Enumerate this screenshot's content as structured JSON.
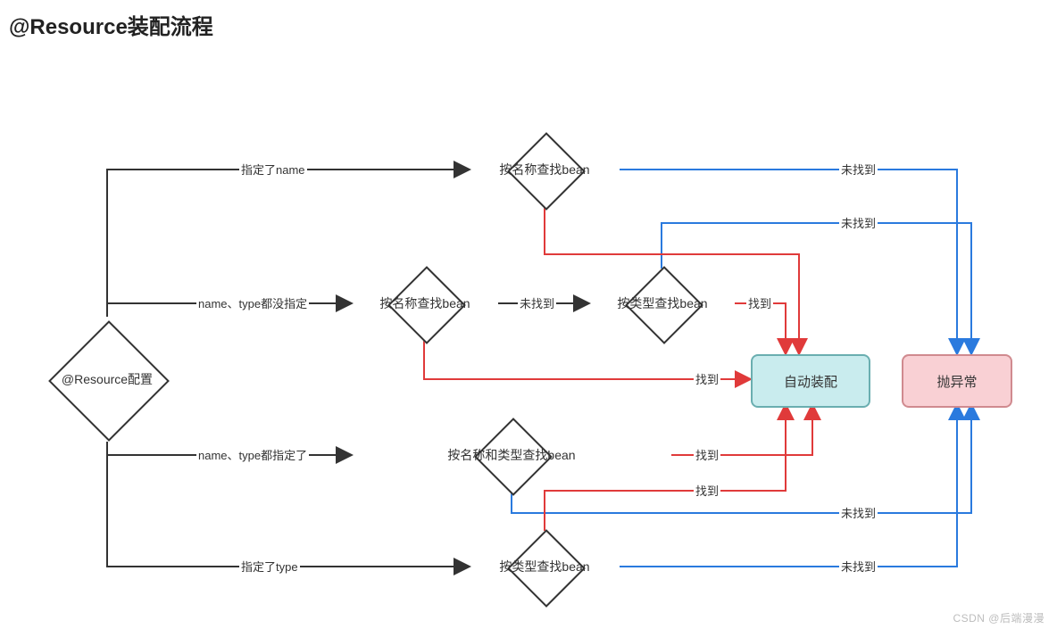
{
  "title": "@Resource装配流程",
  "watermark": "CSDN @后端漫漫",
  "nodes": {
    "root": {
      "label": "@Resource配置"
    },
    "d_name": {
      "label": "按名称查找bean"
    },
    "d_none": {
      "label": "按名称查找bean"
    },
    "d_none2": {
      "label": "按类型查找bean"
    },
    "d_both": {
      "label": "按名称和类型查找bean"
    },
    "d_type": {
      "label": "按类型查找bean"
    },
    "r_auto": {
      "label": "自动装配"
    },
    "r_throw": {
      "label": "抛异常"
    }
  },
  "edges": {
    "root_name": {
      "label": "指定了name"
    },
    "root_none": {
      "label": "name、type都没指定"
    },
    "root_both": {
      "label": "name、type都指定了"
    },
    "root_type": {
      "label": "指定了type"
    },
    "e_notfound1": {
      "label": "未找到"
    },
    "e_notfound2": {
      "label": "未找到"
    },
    "e_notfound3": {
      "label": "未找到"
    },
    "e_notfound4": {
      "label": "未找到"
    },
    "e_notfound5": {
      "label": "未找到"
    },
    "e_found1": {
      "label": "找到"
    },
    "e_found2": {
      "label": "找到"
    },
    "e_found3": {
      "label": "找到"
    },
    "e_found4": {
      "label": "找到"
    }
  }
}
